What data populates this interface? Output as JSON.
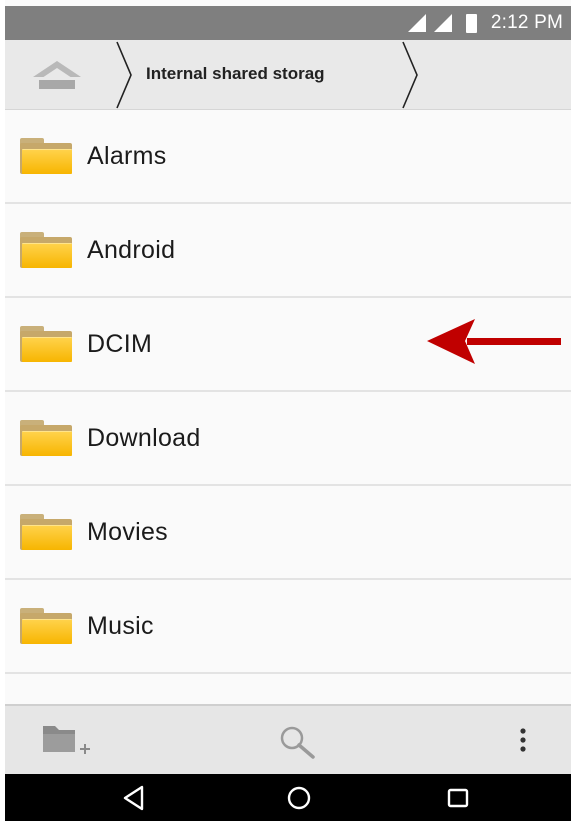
{
  "status_bar": {
    "time": "2:12 PM",
    "icons": [
      "signal-icon",
      "signal-icon",
      "battery-icon"
    ]
  },
  "breadcrumb": {
    "home_icon": "home-icon",
    "path": "Internal shared storag"
  },
  "folders": [
    {
      "name": "Alarms"
    },
    {
      "name": "Android"
    },
    {
      "name": "DCIM"
    },
    {
      "name": "Download"
    },
    {
      "name": "Movies"
    },
    {
      "name": "Music"
    }
  ],
  "annotation": {
    "icon": "red-arrow-icon",
    "color": "#c00000",
    "points_to": "DCIM"
  },
  "toolbar": {
    "new_folder_icon": "new-folder-icon",
    "search_icon": "search-icon",
    "more_icon": "more-vert-icon"
  },
  "navbar": {
    "back_icon": "back-triangle-icon",
    "home_icon": "home-circle-icon",
    "recents_icon": "recents-square-icon"
  },
  "colors": {
    "status_bar": "#7f7f7f",
    "crumb_bar": "#e9e9e9",
    "folder_yellow": "#f7b500",
    "toolbar": "#e6e6e6",
    "navbar": "#000000"
  }
}
